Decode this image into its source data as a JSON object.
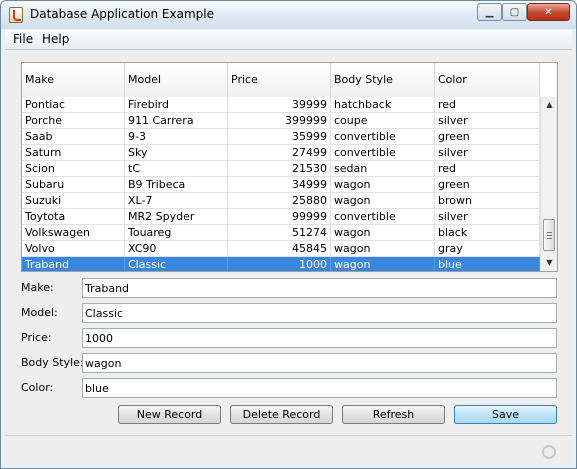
{
  "window": {
    "title": "Database Application Example",
    "minimize_symbol": "▁",
    "maximize_symbol": "▢",
    "close_symbol": "✕"
  },
  "menu": {
    "items": [
      "File",
      "Help"
    ]
  },
  "table": {
    "columns": [
      "Make",
      "Model",
      "Price",
      "Body Style",
      "Color"
    ],
    "rows": [
      [
        "Pontiac",
        "Firebird",
        "39999",
        "hatchback",
        "red"
      ],
      [
        "Porche",
        "911 Carrera",
        "399999",
        "coupe",
        "silver"
      ],
      [
        "Saab",
        "9-3",
        "35999",
        "convertible",
        "green"
      ],
      [
        "Saturn",
        "Sky",
        "27499",
        "convertible",
        "silver"
      ],
      [
        "Scion",
        "tC",
        "21530",
        "sedan",
        "red"
      ],
      [
        "Subaru",
        "B9 Tribeca",
        "34999",
        "wagon",
        "green"
      ],
      [
        "Suzuki",
        "XL-7",
        "25880",
        "wagon",
        "brown"
      ],
      [
        "Toytota",
        "MR2 Spyder",
        "99999",
        "convertible",
        "silver"
      ],
      [
        "Volkswagen",
        "Touareg",
        "51274",
        "wagon",
        "black"
      ],
      [
        "Volvo",
        "XC90",
        "45845",
        "wagon",
        "gray"
      ],
      [
        "Traband",
        "Classic",
        "1000",
        "wagon",
        "blue"
      ]
    ],
    "selected_row": 10,
    "scroll_up_symbol": "▲",
    "scroll_down_symbol": "▼"
  },
  "form": {
    "make_label": "Make:",
    "make_value": "Traband",
    "model_label": "Model:",
    "model_value": "Classic",
    "price_label": "Price:",
    "price_value": "1000",
    "body_style_label": "Body Style:",
    "body_style_value": "wagon",
    "color_label": "Color:",
    "color_value": "blue"
  },
  "buttons": {
    "new_record": "New Record",
    "delete_record": "Delete Record",
    "refresh": "Refresh",
    "save": "Save"
  },
  "colors": {
    "selection": "#3a86dd",
    "primary_button": "#bfe3f9"
  }
}
